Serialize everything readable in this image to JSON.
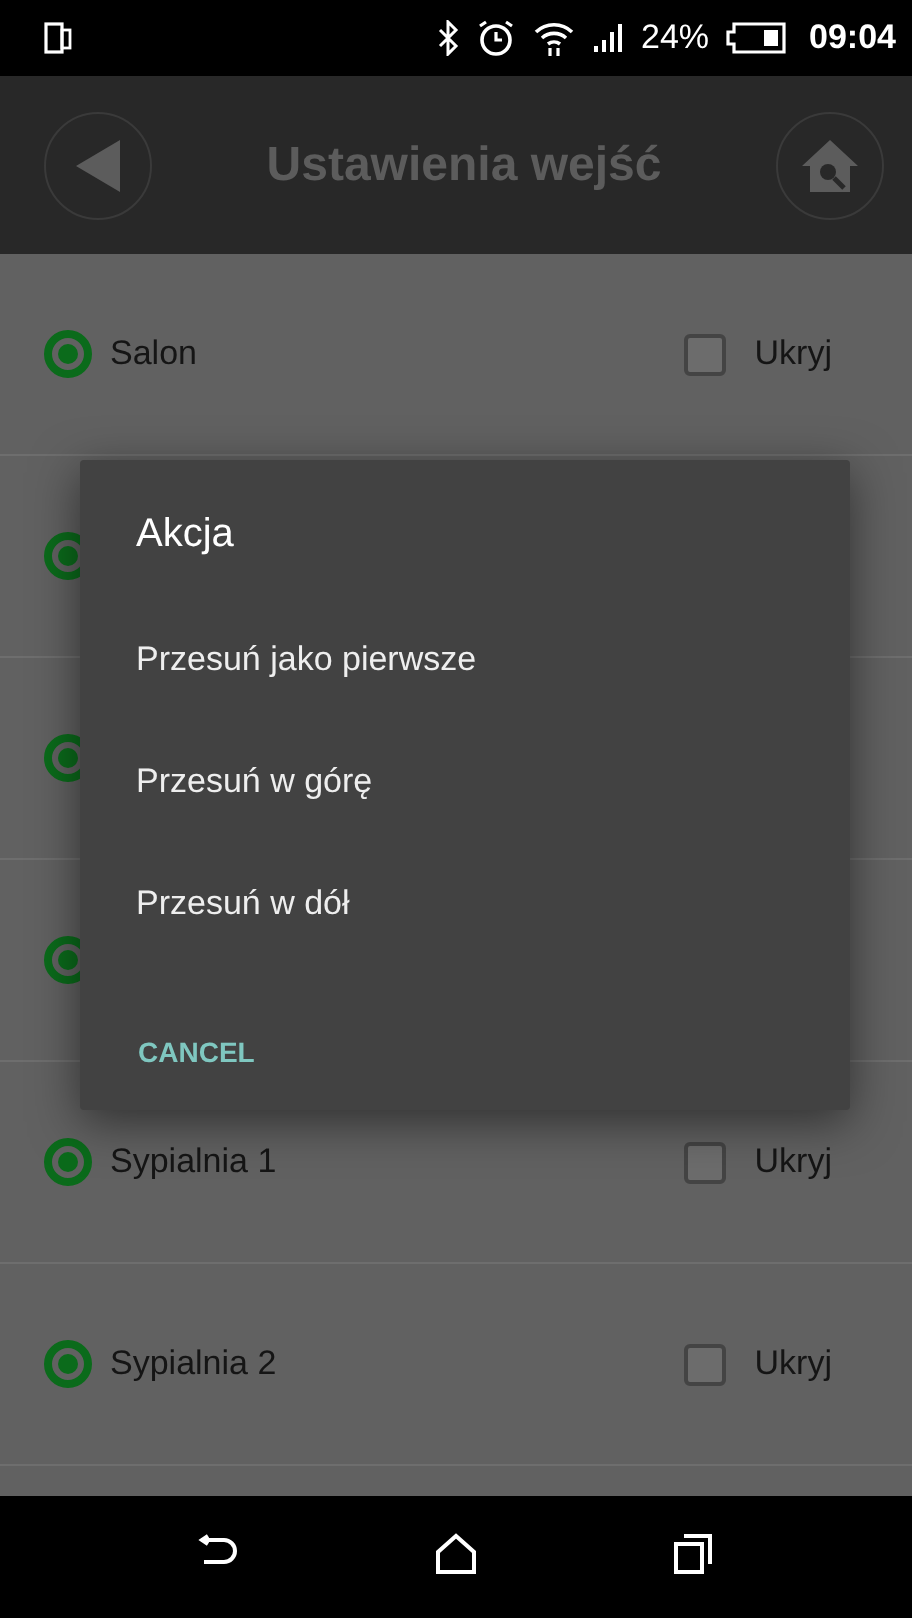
{
  "status_bar": {
    "battery": "24%",
    "time": "09:04"
  },
  "app_bar": {
    "title": "Ustawienia wejść"
  },
  "rows": [
    {
      "name": "Salon",
      "selected": true,
      "hide_label": "Ukryj",
      "hidden": false
    },
    {
      "selected": true
    },
    {
      "selected": true
    },
    {
      "selected": true
    },
    {
      "name": "Sypialnia 1",
      "selected": true,
      "hide_label": "Ukryj",
      "hidden": false
    },
    {
      "name": "Sypialnia 2",
      "selected": true,
      "hide_label": "Ukryj",
      "hidden": false
    },
    {}
  ],
  "dialog": {
    "title": "Akcja",
    "items": [
      "Przesuń jako pierwsze",
      "Przesuń w górę",
      "Przesuń w dół"
    ],
    "cancel": "CANCEL"
  }
}
